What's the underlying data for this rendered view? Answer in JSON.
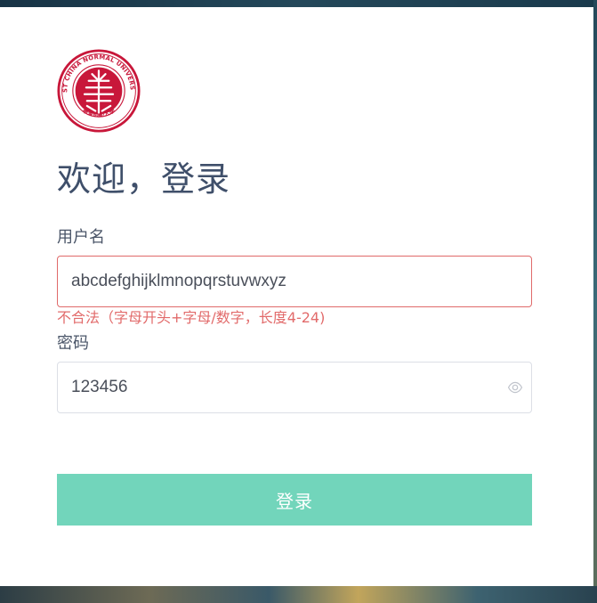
{
  "logo": {
    "ring_text": "EAST CHINA NORMAL UNIVERSITY",
    "chinese_text": "華東師範大學",
    "color": "#c8173a"
  },
  "title": "欢迎，登录",
  "username": {
    "label": "用户名",
    "value": "abcdefghijklmnopqrstuvwxyz",
    "error": "不合法（字母开头+字母/数字，长度4-24)"
  },
  "password": {
    "label": "密码",
    "value": "123456",
    "toggle_icon": "eye-icon"
  },
  "login_button": {
    "label": "登录",
    "color": "#72d5bb"
  },
  "colors": {
    "error": "#e26b6b",
    "title": "#3f4f6a"
  }
}
